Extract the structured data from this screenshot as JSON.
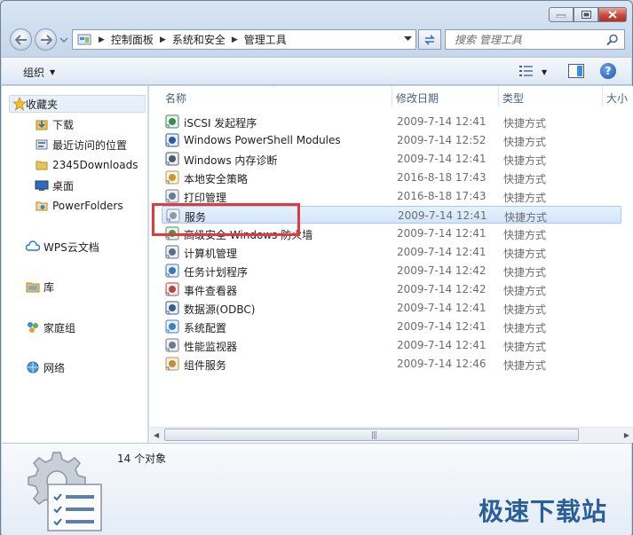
{
  "breadcrumb": [
    "控制面板",
    "系统和安全",
    "管理工具"
  ],
  "search": {
    "placeholder": "搜索 管理工具"
  },
  "toolbar": {
    "organize": "组织"
  },
  "nav": {
    "favorites": "收藏夹",
    "fav_items": [
      "下载",
      "最近访问的位置",
      "2345Downloads",
      "桌面",
      "PowerFolders"
    ],
    "wps": "WPS云文档",
    "library": "库",
    "homegroup": "家庭组",
    "network": "网络"
  },
  "columns": {
    "name": "名称",
    "date": "修改日期",
    "type": "类型",
    "size": "大小"
  },
  "files": [
    {
      "name": "iSCSI 发起程序",
      "date": "2009-7-14 12:41",
      "type": "快捷方式",
      "icon": "globe-icon"
    },
    {
      "name": "Windows PowerShell Modules",
      "date": "2009-7-14 12:52",
      "type": "快捷方式",
      "icon": "powershell-icon"
    },
    {
      "name": "Windows 内存诊断",
      "date": "2009-7-14 12:41",
      "type": "快捷方式",
      "icon": "memory-icon"
    },
    {
      "name": "本地安全策略",
      "date": "2016-8-18 17:43",
      "type": "快捷方式",
      "icon": "policy-icon"
    },
    {
      "name": "打印管理",
      "date": "2016-8-18 17:43",
      "type": "快捷方式",
      "icon": "printer-icon"
    },
    {
      "name": "服务",
      "date": "2009-7-14 12:41",
      "type": "快捷方式",
      "icon": "services-icon"
    },
    {
      "name": "高级安全 Windows 防火墙",
      "date": "2009-7-14 12:41",
      "type": "快捷方式",
      "icon": "firewall-icon"
    },
    {
      "name": "计算机管理",
      "date": "2009-7-14 12:41",
      "type": "快捷方式",
      "icon": "computer-icon"
    },
    {
      "name": "任务计划程序",
      "date": "2009-7-14 12:42",
      "type": "快捷方式",
      "icon": "clock-icon"
    },
    {
      "name": "事件查看器",
      "date": "2009-7-14 12:42",
      "type": "快捷方式",
      "icon": "event-icon"
    },
    {
      "name": "数据源(ODBC)",
      "date": "2009-7-14 12:41",
      "type": "快捷方式",
      "icon": "odbc-icon"
    },
    {
      "name": "系统配置",
      "date": "2009-7-14 12:41",
      "type": "快捷方式",
      "icon": "config-icon"
    },
    {
      "name": "性能监视器",
      "date": "2009-7-14 12:41",
      "type": "快捷方式",
      "icon": "perf-icon"
    },
    {
      "name": "组件服务",
      "date": "2009-7-14 12:46",
      "type": "快捷方式",
      "icon": "component-icon"
    }
  ],
  "status": {
    "count": "14 个对象"
  },
  "watermark": "极速下载站",
  "colors": {
    "highlight": "#e23a3a",
    "selection": "#d2e5fb",
    "accent": "#2a5f9a"
  }
}
